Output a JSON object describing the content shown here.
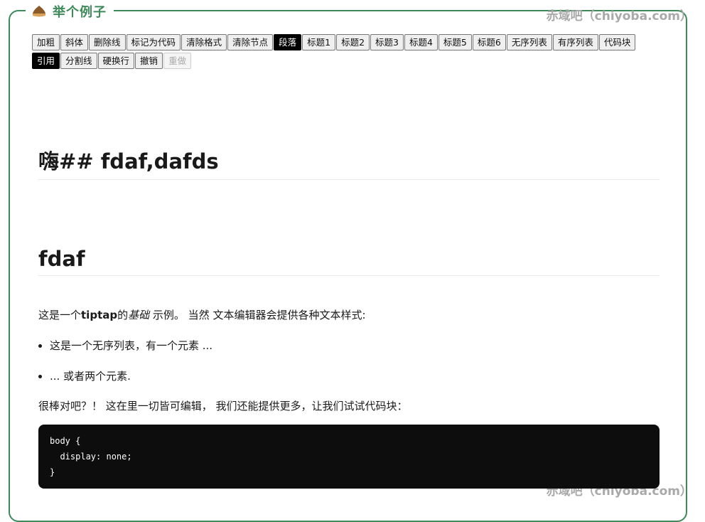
{
  "header": {
    "title": "举个例子",
    "watermark": "赤域吧（chiyoba.com）"
  },
  "toolbar": {
    "buttons": [
      {
        "label": "加粗"
      },
      {
        "label": "斜体"
      },
      {
        "label": "删除线"
      },
      {
        "label": "标记为代码"
      },
      {
        "label": "清除格式"
      },
      {
        "label": "清除节点"
      },
      {
        "label": "段落",
        "active": true
      },
      {
        "label": "标题1"
      },
      {
        "label": "标题2"
      },
      {
        "label": "标题3"
      },
      {
        "label": "标题4"
      },
      {
        "label": "标题5"
      },
      {
        "label": "标题6"
      },
      {
        "label": "无序列表"
      },
      {
        "label": "有序列表"
      },
      {
        "label": "代码块"
      },
      {
        "label": "引用",
        "active": true
      },
      {
        "label": "分割线"
      },
      {
        "label": "硬换行"
      },
      {
        "label": "撤销"
      },
      {
        "label": "重做",
        "disabled": true
      }
    ]
  },
  "editor": {
    "heading1": "嗨## fdaf,dafds",
    "heading2": "fdaf",
    "intro": {
      "pre": "这是一个",
      "bold": "tiptap",
      "mid": "的",
      "italic": "基础",
      "post": " 示例。 当然 文本编辑器会提供各种文本样式:"
    },
    "list_items": [
      "这是一个无序列表，有一个元素 ...",
      "... 或者两个元素."
    ],
    "para2": "很棒对吧？！ 这在里一切皆可编辑， 我们还能提供更多，让我们试试代码块：",
    "code": "body {\n  display: none;\n}"
  }
}
